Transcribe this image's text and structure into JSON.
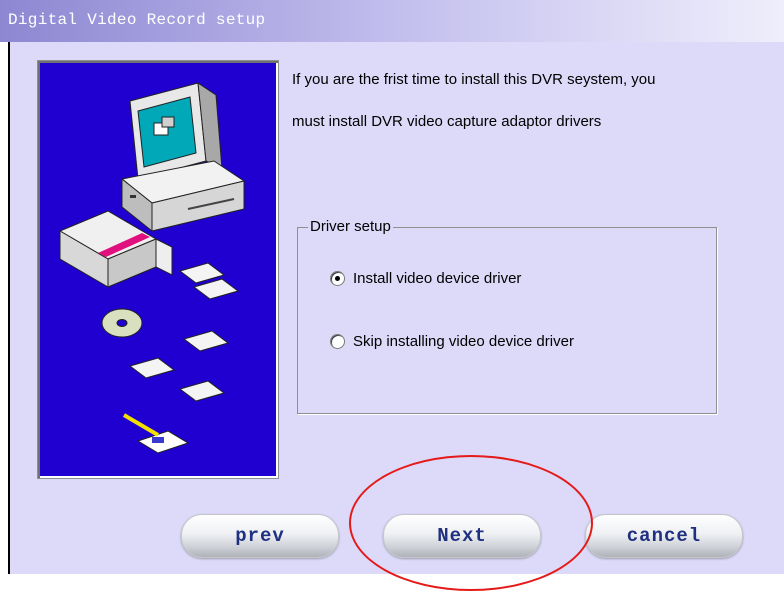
{
  "window": {
    "title": "Digital Video Record setup"
  },
  "message": {
    "line1": "If you are the frist time to install this DVR seystem, you",
    "line2": "must install  DVR  video capture adaptor  drivers"
  },
  "driver_setup": {
    "legend": "Driver setup",
    "options": [
      {
        "label": "Install video device driver",
        "selected": true
      },
      {
        "label": "Skip installing video device driver",
        "selected": false
      }
    ]
  },
  "buttons": {
    "prev": "prev",
    "next": "Next",
    "cancel": "cancel"
  },
  "annotation": {
    "highlight": "Next",
    "color": "#e51b1b"
  },
  "colors": {
    "art_background": "#1f00d0",
    "panel": "#dcdaf8"
  }
}
